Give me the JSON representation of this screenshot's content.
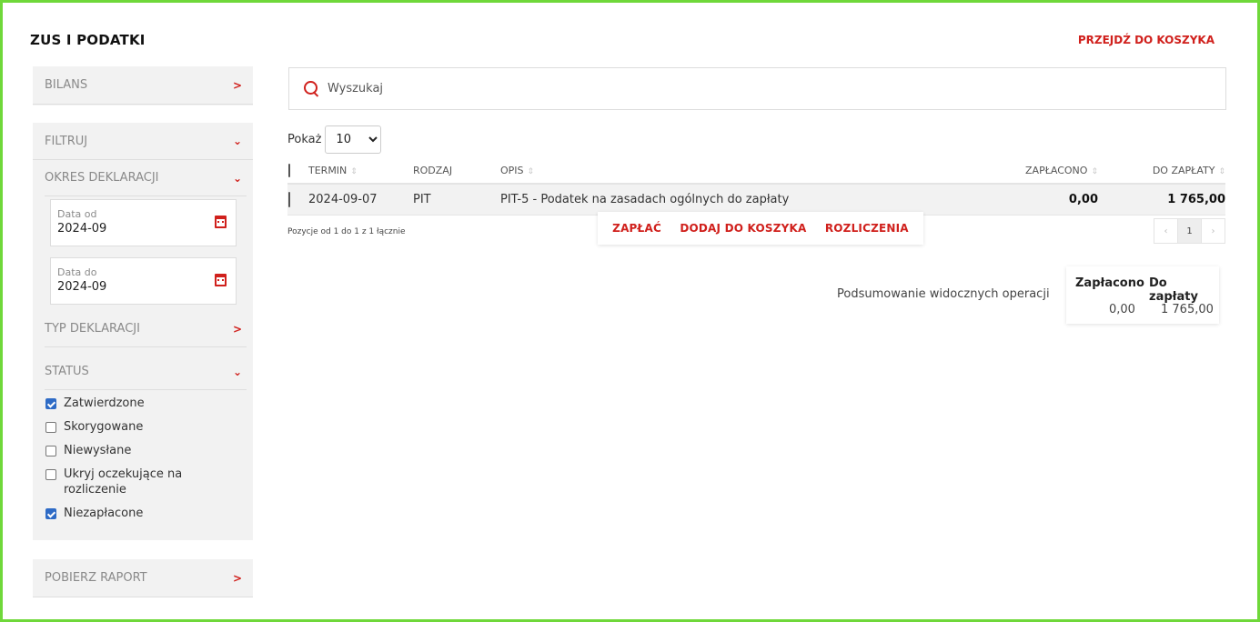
{
  "page": {
    "title": "ZUS I PODATKI",
    "cart_link": "PRZEJDŹ DO KOSZYKA"
  },
  "sidebar": {
    "bilans": {
      "label": "BILANS",
      "icon": "chevron-right-icon"
    },
    "filter": {
      "label": "FILTRUJ",
      "icon": "chevron-down-icon",
      "period": {
        "label": "OKRES DEKLARACJI",
        "date_from": {
          "label": "Data od",
          "value": "2024-09",
          "icon": "calendar-icon"
        },
        "date_to": {
          "label": "Data do",
          "value": "2024-09",
          "icon": "calendar-icon"
        }
      },
      "type": {
        "label": "TYP DEKLARACJI",
        "icon": "chevron-right-icon"
      },
      "status": {
        "label": "STATUS",
        "icon": "chevron-down-icon",
        "options": [
          {
            "label": "Zatwierdzone",
            "checked": true
          },
          {
            "label": "Skorygowane",
            "checked": false
          },
          {
            "label": "Niewysłane",
            "checked": false
          },
          {
            "label": "Ukryj oczekujące na rozliczenie",
            "checked": false
          },
          {
            "label": "Niezapłacone",
            "checked": true
          }
        ]
      }
    },
    "report": {
      "label": "POBIERZ RAPORT",
      "icon": "chevron-right-icon"
    }
  },
  "search": {
    "placeholder": "Wyszukaj",
    "value": "",
    "icon": "search-icon"
  },
  "page_size": {
    "label": "Pokaż",
    "value": "10"
  },
  "table": {
    "headers": {
      "termin": "TERMIN",
      "rodzaj": "RODZAJ",
      "opis": "OPIS",
      "zaplacono": "ZAPŁACONO",
      "do_zaplaty": "DO ZAPŁATY"
    },
    "rows": [
      {
        "termin": "2024-09-07",
        "rodzaj": "PIT",
        "opis": "PIT-5 - Podatek na zasadach ogólnych do zapłaty",
        "zaplacono": "0,00",
        "do_zaplaty": "1 765,00",
        "checked": false
      }
    ],
    "info": "Pozycje od 1 do 1 z 1 łącznie"
  },
  "actions": {
    "pay": "ZAPŁAĆ",
    "add_to_cart": "DODAJ DO KOSZYKA",
    "settlements": "ROZLICZENIA"
  },
  "pagination": {
    "prev": "‹",
    "current": "1",
    "next": "›"
  },
  "summary": {
    "label": "Podsumowanie widocznych operacji",
    "paid_header": "Zapłacono",
    "due_header": "Do zapłaty",
    "paid_value": "0,00",
    "due_value": "1 765,00"
  },
  "colors": {
    "accent": "#d0201c",
    "checkbox": "#2e6bc6",
    "frame": "#6fd83a"
  }
}
